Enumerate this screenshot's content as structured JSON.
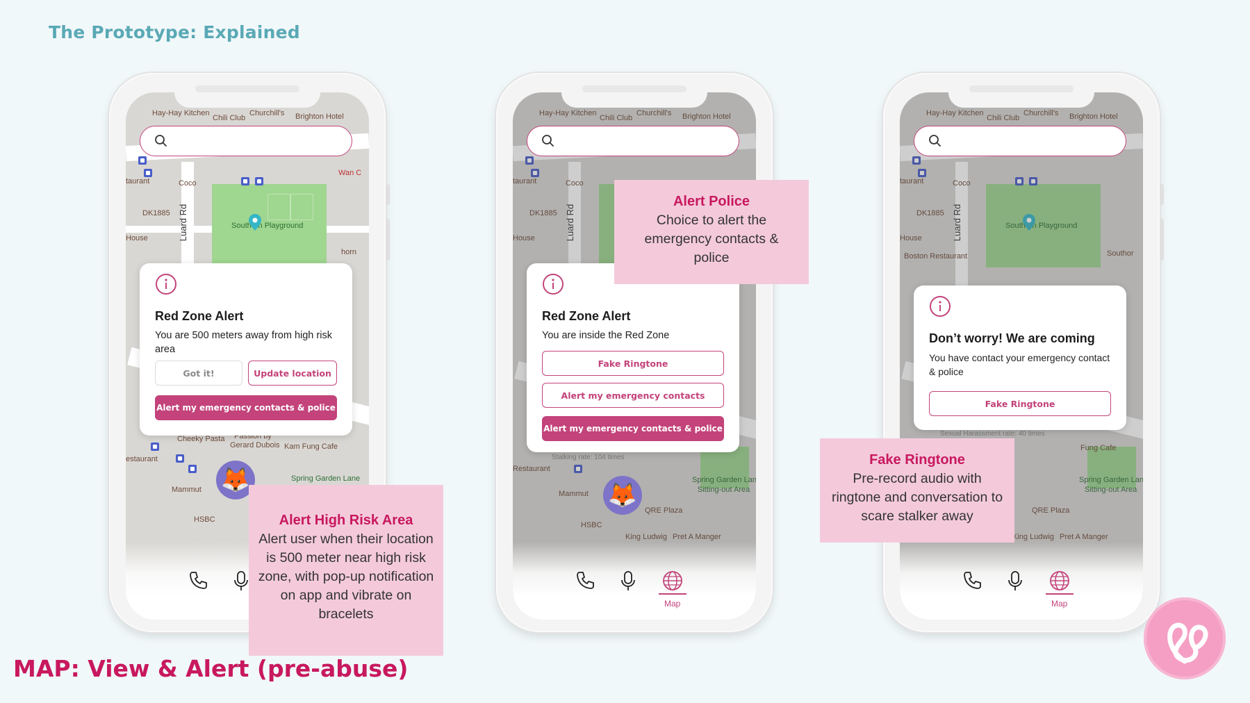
{
  "slide": {
    "title": "The Prototype: Explained",
    "footer_title": "MAP: View & Alert (pre-abuse)"
  },
  "map_labels": {
    "hay_hay_kitchen": "Hay-Hay Kitchen",
    "chili_club": "Chili Club",
    "churchills": "Churchill's",
    "brighton_hotel": "Brighton Hotel",
    "coco": "Coco",
    "wan": "Wan C",
    "taurant": "taurant",
    "dk1885": "DK1885",
    "luard_rd": "Luard Rd",
    "southorn_playground": "Southorn Playground",
    "house": "House",
    "horn": "horn",
    "cheeky_pasta": "Cheeky Pasta",
    "passion_by": "Passion by",
    "gerard_dubois": "Gerard Dubois",
    "kam_fung_cafe": "Kam Fung Cafe",
    "spring_garden_lane": "Spring Garden Lane",
    "mammut": "Mammut",
    "hsbc": "HSBC",
    "estaurant": "estaurant",
    "qre_plaza": "QRE Plaza",
    "king_ludwig": "King Ludwig",
    "pret_a_manger": "Pret A Manger",
    "sitting_out_area": "Sitting-out Area",
    "fung_cafe": "Fung Cafe",
    "boston_restaurant": "Boston Restaurant",
    "southor": "Southor",
    "stalking_rate": "Stalking rate: 104 times",
    "sexual_harassment_rate": "Sexual Harassment rate: 40 times",
    "restaurant": "Restaurant"
  },
  "phone1": {
    "card": {
      "title": "Red Zone Alert",
      "message": "You are 500 meters away from high risk area",
      "got_it": "Got it!",
      "update_location": "Update location",
      "alert_all": "Alert my emergency contacts & police"
    },
    "callout": {
      "title": "Alert High Risk Area",
      "body": "Alert user when their location is 500 meter near high risk zone, with pop-up notification on app and vibrate on bracelets"
    }
  },
  "phone2": {
    "card": {
      "title": "Red Zone Alert",
      "message": "You are inside the Red Zone",
      "fake_ringtone": "Fake Ringtone",
      "alert_contacts": "Alert my emergency contacts",
      "alert_all": "Alert my emergency contacts & police"
    },
    "callout": {
      "title": "Alert Police",
      "body": "Choice to alert the emergency contacts & police"
    },
    "nav": {
      "map_label": "Map"
    }
  },
  "phone3": {
    "card": {
      "title": "Don’t worry! We are coming",
      "message": "You have contact your emergency contact & police",
      "fake_ringtone": "Fake Ringtone"
    },
    "callout": {
      "title": "Fake Ringtone",
      "body": "Pre-record audio with ringtone and conversation to scare stalker away"
    },
    "nav": {
      "map_label": "Map"
    }
  },
  "icons": [
    "search-icon",
    "info-icon",
    "phone-icon",
    "microphone-icon",
    "globe-icon",
    "fox-avatar-icon",
    "location-pin-icon",
    "bus-stop-icon"
  ],
  "colors": {
    "accent": "#c3437a",
    "callout_bg": "#f4cadb",
    "callout_title": "#c8185e",
    "slide_title": "#5aa9b5",
    "park": "#9fd690"
  }
}
